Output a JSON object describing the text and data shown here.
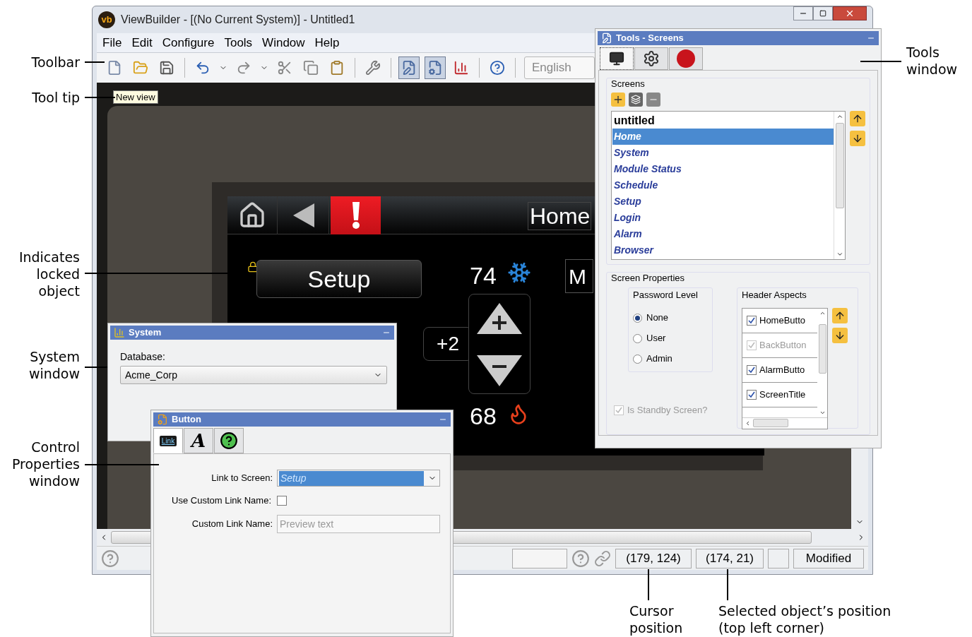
{
  "window": {
    "logo": "vb",
    "title": "ViewBuilder - [(No Current System)] - Untitled1"
  },
  "menu": [
    "File",
    "Edit",
    "Configure",
    "Tools",
    "Window",
    "Help"
  ],
  "toolbar": {
    "groups": [
      [
        {
          "kind": "new",
          "pressed": false
        },
        {
          "kind": "open",
          "pressed": false
        },
        {
          "kind": "save",
          "pressed": false
        }
      ],
      [
        {
          "kind": "undo",
          "pressed": false
        },
        {
          "kind": "dropdown",
          "pressed": false
        },
        {
          "kind": "redo",
          "pressed": false
        },
        {
          "kind": "dropdown",
          "pressed": false
        },
        {
          "kind": "cut",
          "pressed": false
        },
        {
          "kind": "copy",
          "pressed": false
        },
        {
          "kind": "paste",
          "pressed": false
        }
      ],
      [
        {
          "kind": "tools",
          "pressed": false
        }
      ],
      [
        {
          "kind": "edit",
          "pressed": true
        },
        {
          "kind": "properties",
          "pressed": true
        },
        {
          "kind": "chart",
          "pressed": false
        }
      ],
      [
        {
          "kind": "help",
          "pressed": false
        }
      ]
    ],
    "language": "English"
  },
  "tooltip": "New view",
  "canvas": {
    "nav_title": "Home",
    "setup_button": "Setup",
    "setup_locked": true,
    "cool_setpoint": "74",
    "heat_setpoint": "68",
    "offset": "+2",
    "mode_button": "M"
  },
  "system_window": {
    "title": "System",
    "database_label": "Database:",
    "database": "Acme_Corp"
  },
  "button_window": {
    "title": "Button",
    "tabs": [
      {
        "kind": "link",
        "label": "Link",
        "selected": true
      },
      {
        "kind": "font",
        "label": "A",
        "selected": false
      },
      {
        "kind": "help",
        "selected": false
      }
    ],
    "link_label": "Link to Screen:",
    "link_value": "Setup",
    "custom_label": "Use Custom Link Name:",
    "custom_checked": false,
    "name_label": "Custom Link Name:",
    "name_placeholder": "Preview text"
  },
  "tools_window": {
    "title": "Tools - Screens",
    "tabs": [
      {
        "kind": "screen",
        "selected": true
      },
      {
        "kind": "gear",
        "selected": false
      },
      {
        "kind": "alarm",
        "selected": false
      }
    ],
    "screens_title": "Screens",
    "screens": [
      {
        "kind": "root",
        "label": "untitled",
        "selected": false
      },
      {
        "kind": "screen",
        "label": "Home",
        "selected": true
      },
      {
        "kind": "screen",
        "label": "System",
        "selected": false
      },
      {
        "kind": "screen",
        "label": "Module Status",
        "selected": false
      },
      {
        "kind": "screen",
        "label": "Schedule",
        "selected": false
      },
      {
        "kind": "screen",
        "label": "Setup",
        "selected": false
      },
      {
        "kind": "screen",
        "label": "Login",
        "selected": false
      },
      {
        "kind": "screen",
        "label": "Alarm",
        "selected": false
      },
      {
        "kind": "screen",
        "label": "Browser",
        "selected": false
      }
    ],
    "properties_title": "Screen Properties",
    "password_title": "Password Level",
    "password_levels": [
      {
        "label": "None",
        "selected": true
      },
      {
        "label": "User",
        "selected": false
      },
      {
        "label": "Admin",
        "selected": false
      }
    ],
    "header_title": "Header Aspects",
    "header_aspects": [
      {
        "label": "HomeButto",
        "checked": true,
        "disabled": false
      },
      {
        "label": "BackButton",
        "checked": true,
        "disabled": true
      },
      {
        "label": "AlarmButto",
        "checked": true,
        "disabled": false
      },
      {
        "label": "ScreenTitle",
        "checked": true,
        "disabled": false
      }
    ],
    "standby_label": "Is Standby Screen?",
    "standby_checked": true,
    "standby_disabled": true
  },
  "status_bar": {
    "cursor": "(179, 124)",
    "selection": "(174, 21)",
    "state": "Modified"
  },
  "annotations": [
    {
      "lines": [
        "Toolbar"
      ]
    },
    {
      "lines": [
        "Tool tip"
      ]
    },
    {
      "lines": [
        "Indicates",
        "locked",
        "object"
      ]
    },
    {
      "lines": [
        "System",
        "window"
      ]
    },
    {
      "lines": [
        "Control",
        "Properties",
        "window"
      ]
    },
    {
      "lines": [
        "Tools",
        "window"
      ]
    },
    {
      "lines": [
        "Cursor",
        "position"
      ]
    },
    {
      "lines": [
        "Selected object’s position",
        "(top left corner)"
      ]
    }
  ]
}
